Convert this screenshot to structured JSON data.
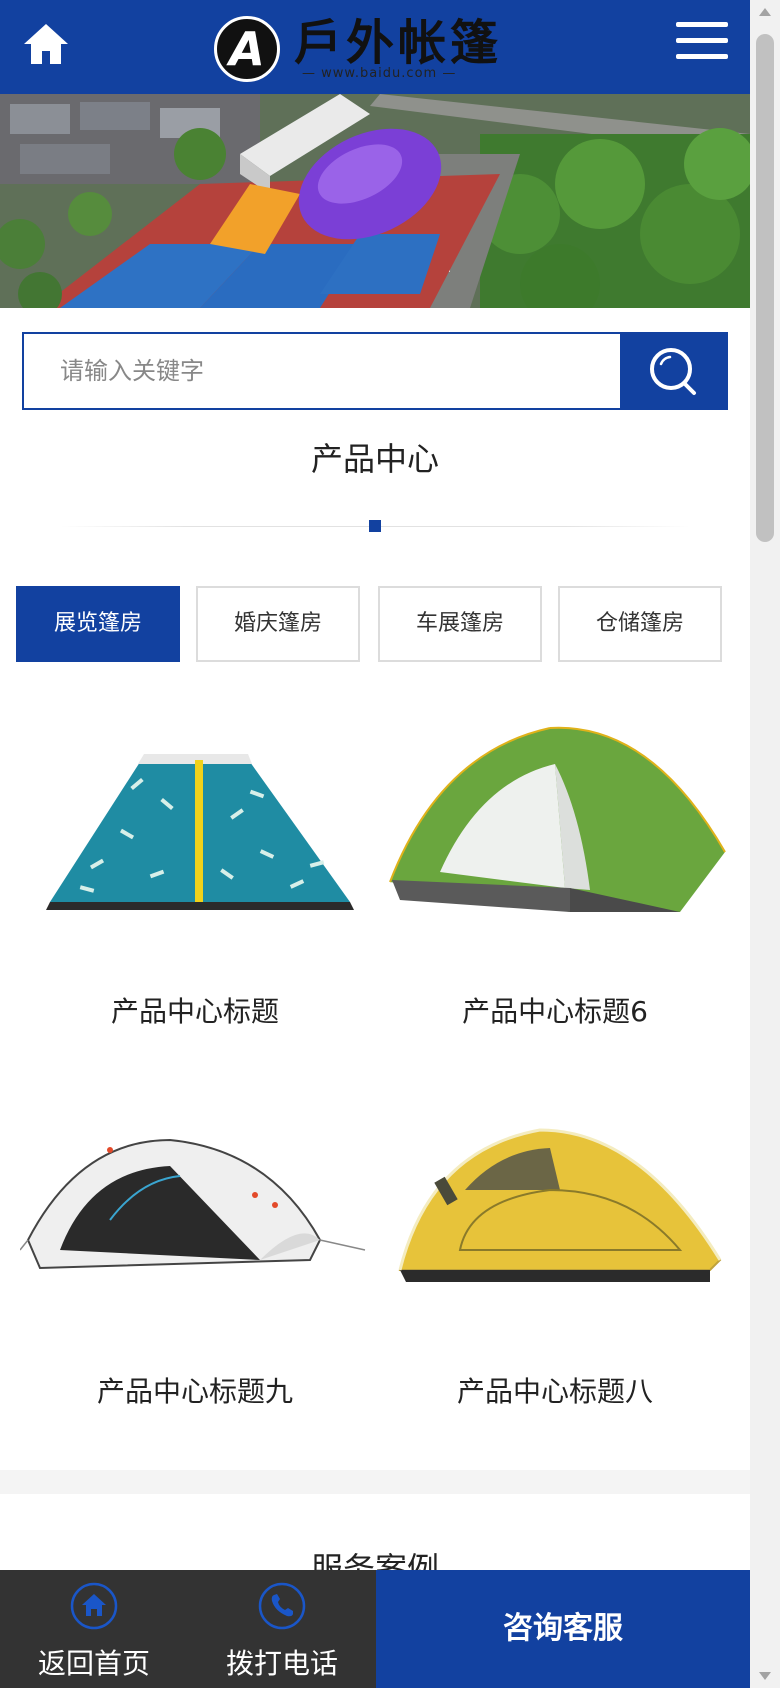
{
  "header": {
    "logo_mark": "A",
    "logo_text": "戶外帐篷",
    "logo_sub": "— www.baidu.com —",
    "home_icon": "home-icon",
    "menu_icon": "hamburger-menu-icon"
  },
  "search": {
    "placeholder": "请输入关键字",
    "button_icon": "search-icon"
  },
  "products_section": {
    "title": "产品中心",
    "tabs": [
      {
        "label": "展览篷房",
        "active": true
      },
      {
        "label": "婚庆篷房",
        "active": false
      },
      {
        "label": "车展篷房",
        "active": false
      },
      {
        "label": "仓储篷房",
        "active": false
      }
    ],
    "items": [
      {
        "title": "产品中心标题",
        "image": "teal-patterned-tent"
      },
      {
        "title": "产品中心标题6",
        "image": "green-dome-tent"
      },
      {
        "title": "产品中心标题九",
        "image": "white-popup-tent"
      },
      {
        "title": "产品中心标题八",
        "image": "yellow-dome-tent"
      }
    ]
  },
  "cases_section": {
    "title": "服务案例"
  },
  "bottom_bar": {
    "home_label": "返回首页",
    "home_icon": "home-circle-icon",
    "phone_label": "拨打电话",
    "phone_icon": "phone-circle-icon",
    "consult_label": "咨询客服"
  },
  "colors": {
    "brand_blue": "#1241a0",
    "bottom_dark": "#333333"
  }
}
